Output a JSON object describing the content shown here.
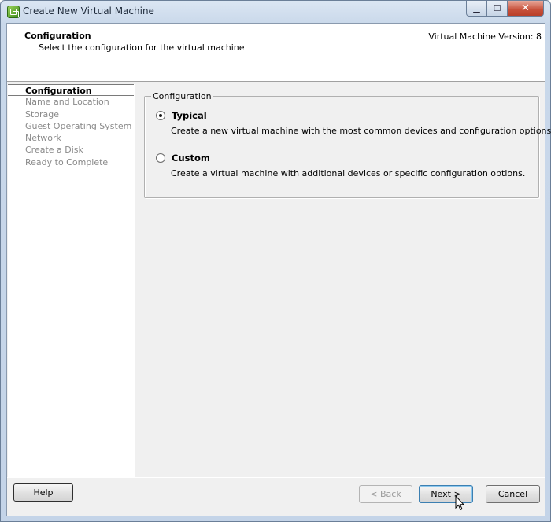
{
  "window": {
    "title": "Create New Virtual Machine",
    "minimize_glyph": "▁",
    "maximize_glyph": "☐",
    "close_glyph": "✕"
  },
  "header": {
    "title": "Configuration",
    "subtitle": "Select the configuration for the virtual machine",
    "version": "Virtual Machine Version: 8"
  },
  "steps": [
    {
      "label": "Configuration",
      "active": true
    },
    {
      "label": "Name and Location",
      "active": false
    },
    {
      "label": "Storage",
      "active": false
    },
    {
      "label": "Guest Operating System",
      "active": false
    },
    {
      "label": "Network",
      "active": false
    },
    {
      "label": "Create a Disk",
      "active": false
    },
    {
      "label": "Ready to Complete",
      "active": false
    }
  ],
  "configuration": {
    "group_label": "Configuration",
    "options": [
      {
        "label": "Typical",
        "description": "Create a new virtual machine with the most common devices and configuration options.",
        "selected": true
      },
      {
        "label": "Custom",
        "description": "Create a virtual machine with additional devices or specific configuration options.",
        "selected": false
      }
    ]
  },
  "footer": {
    "help_label": "Help",
    "back_label": "< Back",
    "next_label": "Next >",
    "cancel_label": "Cancel"
  }
}
